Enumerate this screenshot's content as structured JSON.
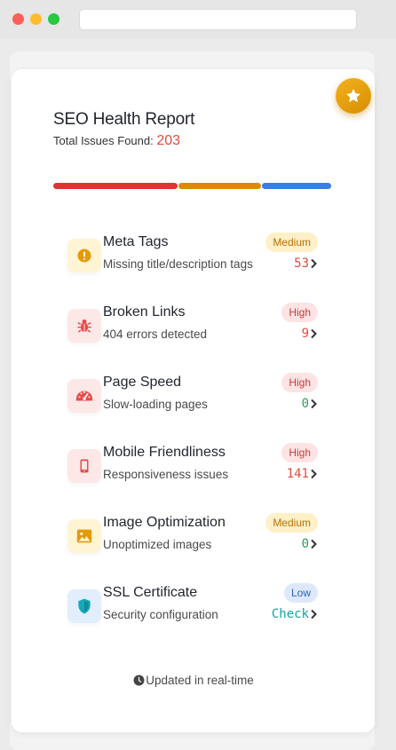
{
  "window": {
    "accent": "#e8a70c"
  },
  "header": {
    "title": "SEO Health Report",
    "subtitle_label": "Total Issues Found:",
    "total_issues": "203"
  },
  "progress": {
    "segments": [
      {
        "color": "#e23232"
      },
      {
        "color": "#dd8a08"
      },
      {
        "color": "#3a7de6"
      }
    ]
  },
  "items": [
    {
      "title": "Meta Tags",
      "description": "Missing title/description tags",
      "severity": "Medium",
      "value": "53",
      "icon": "exclamation-icon"
    },
    {
      "title": "Broken Links",
      "description": "404 errors detected",
      "severity": "High",
      "value": "9",
      "icon": "bug-icon"
    },
    {
      "title": "Page Speed",
      "description": "Slow-loading pages",
      "severity": "High",
      "value": "0",
      "icon": "speedometer-icon"
    },
    {
      "title": "Mobile Friendliness",
      "description": "Responsiveness issues",
      "severity": "High",
      "value": "141",
      "icon": "mobile-phone-icon"
    },
    {
      "title": "Image Optimization",
      "description": "Unoptimized images",
      "severity": "Medium",
      "value": "0",
      "icon": "image-icon"
    },
    {
      "title": "SSL Certificate",
      "description": "Security configuration",
      "severity": "Low",
      "value": "Check",
      "icon": "shield-icon"
    }
  ],
  "footer": {
    "text": "Updated in real-time",
    "icon": "clock-icon"
  }
}
